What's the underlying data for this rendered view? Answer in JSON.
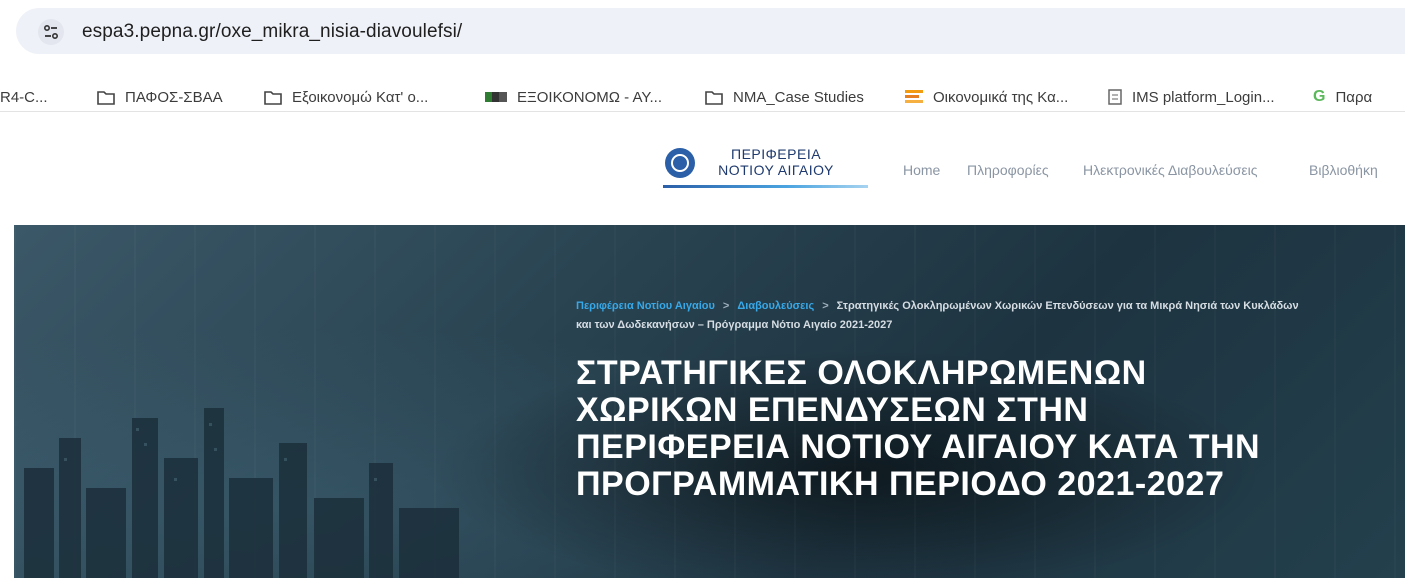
{
  "browser": {
    "url": "espa3.pepna.gr/oxe_mikra_nisia-diavoulefsi/"
  },
  "bookmarks": [
    {
      "label": "R4-C...",
      "icon": "none"
    },
    {
      "label": "ΠΑΦΟΣ-ΣΒΑΑ",
      "icon": "folder-icon"
    },
    {
      "label": "Εξοικονομώ Κατ' ο...",
      "icon": "folder-icon"
    },
    {
      "label": "ΕΞΟΙΚΟΝΟΜΩ - ΑΥ...",
      "icon": "flag-icon"
    },
    {
      "label": "NMA_Case Studies",
      "icon": "folder-icon"
    },
    {
      "label": "Οικονομικά της Κα...",
      "icon": "bars-icon"
    },
    {
      "label": "IMS platform_Login...",
      "icon": "page-icon"
    },
    {
      "label": "Παρα",
      "icon": "g-icon"
    }
  ],
  "site": {
    "logo_line1": "ΠΕΡΙΦΕΡΕΙΑ",
    "logo_line2": "ΝΟΤΙΟΥ ΑΙΓΑΙΟΥ",
    "nav": [
      "Home",
      "Πληροφορίες",
      "Ηλεκτρονικές Διαβουλεύσεις",
      "Βιβλιοθήκη"
    ]
  },
  "hero": {
    "breadcrumb": {
      "home": "Περιφέρεια Νοτίου Αιγαίου",
      "section": "Διαβουλεύσεις",
      "separator": ">",
      "current": "Στρατηγικές Ολοκληρωμένων Χωρικών Επενδύσεων για τα Μικρά Νησιά των Κυκλάδων και των Δωδεκανήσων – Πρόγραμμα Νότιο Αιγαίο 2021-2027"
    },
    "title_lines": [
      "ΣΤΡΑΤΗΓΙΚΕΣ ΟΛΟΚΛΗΡΩΜΕΝΩΝ",
      "ΧΩΡΙΚΩΝ ΕΠΕΝΔΥΣΕΩΝ ΣΤΗΝ",
      "ΠΕΡΙΦΕΡΕΙΑ ΝΟΤΙΟΥ ΑΙΓΑΙΟΥ ΚΑΤΑ ΤΗΝ",
      "ΠΡΟΓΡΑΜΜΑΤΙΚΗ ΠΕΡΙΟΔΟ 2021-2027"
    ]
  },
  "colors": {
    "link_blue": "#37a8e8",
    "hero_bg": "#2a4452",
    "nav_text": "#8a95a3"
  }
}
